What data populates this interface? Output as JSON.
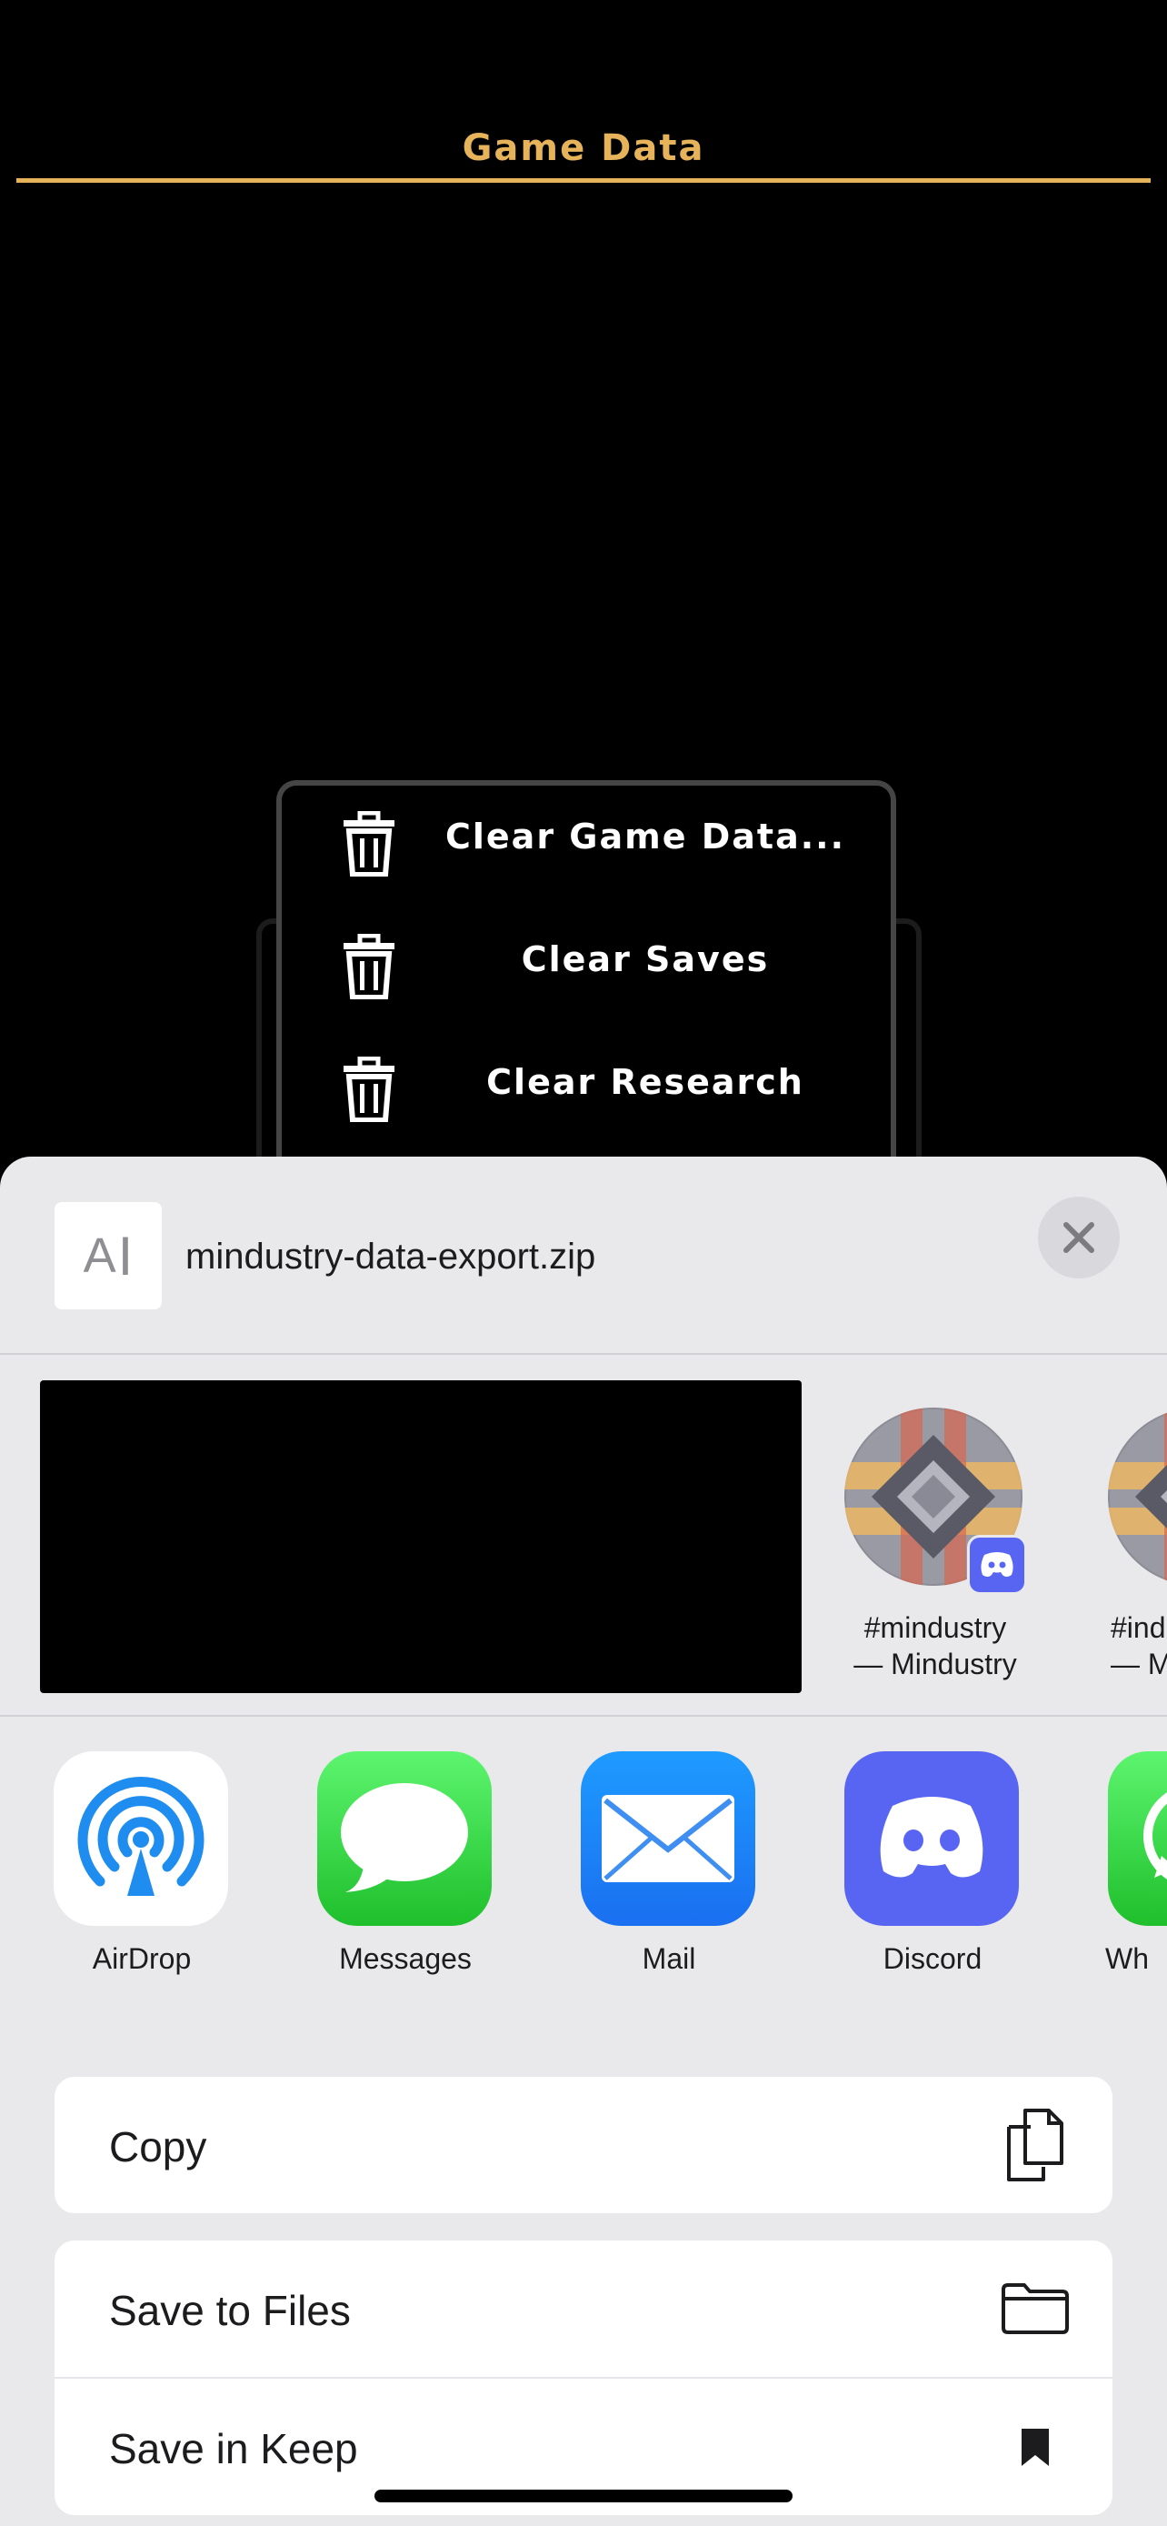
{
  "game": {
    "title": "Game Data",
    "accent_color": "#e6b25a",
    "menu": [
      {
        "label": "Clear Game Data...",
        "icon": "trash-icon"
      },
      {
        "label": "Clear Saves",
        "icon": "trash-icon"
      },
      {
        "label": "Clear Research",
        "icon": "trash-icon"
      }
    ]
  },
  "share_sheet": {
    "file_name": "mindustry-data-export.zip",
    "file_icon_text": "A",
    "close_icon": "close-icon",
    "contacts": [
      {
        "line1": "#mindustry",
        "line2": "— Mindustry",
        "badge": "discord-icon"
      },
      {
        "line1": "#ind",
        "line2": "— M",
        "badge": "discord-icon"
      }
    ],
    "apps": [
      {
        "label": "AirDrop",
        "icon": "airdrop-icon"
      },
      {
        "label": "Messages",
        "icon": "messages-icon"
      },
      {
        "label": "Mail",
        "icon": "mail-icon"
      },
      {
        "label": "Discord",
        "icon": "discord-icon"
      },
      {
        "label": "Wh",
        "icon": "whatsapp-icon"
      }
    ],
    "actions": [
      {
        "label": "Copy",
        "icon": "copy-icon"
      },
      {
        "label": "Save to Files",
        "icon": "folder-icon"
      },
      {
        "label": "Save in Keep",
        "icon": "bookmark-icon"
      }
    ]
  }
}
